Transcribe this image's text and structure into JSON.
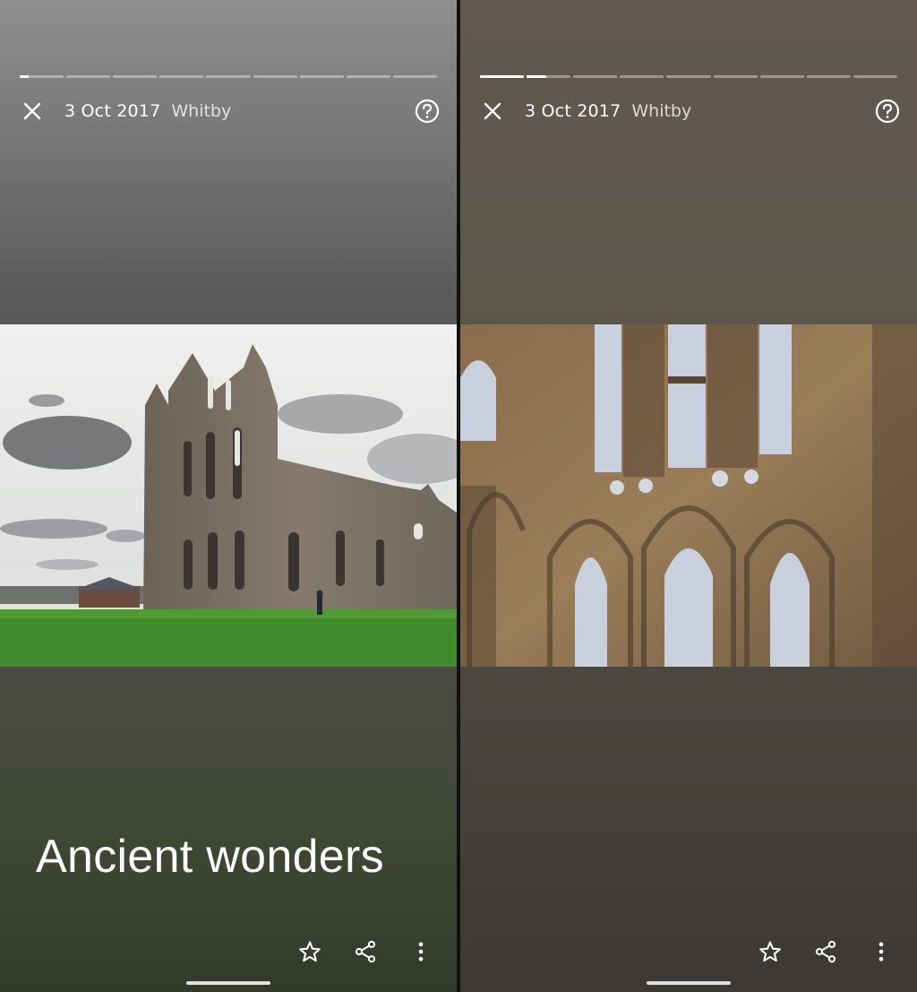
{
  "stories": [
    {
      "date": "3 Oct 2017",
      "place": "Whitby",
      "title": "Ancient wonders",
      "progress": {
        "segments": 9,
        "active_index": 0,
        "active_fill": 0.2
      }
    },
    {
      "date": "3 Oct 2017",
      "place": "Whitby",
      "title": "",
      "progress": {
        "segments": 9,
        "active_index": 1,
        "active_fill": 0.45
      }
    }
  ],
  "icons": {
    "close": "close-icon",
    "help": "help-icon",
    "favorite": "star-outline-icon",
    "share": "share-icon",
    "more": "more-vertical-icon"
  },
  "colors": {
    "icon": "#ffffff",
    "grass": "#3f8a2a",
    "stone": "#8a7055"
  }
}
